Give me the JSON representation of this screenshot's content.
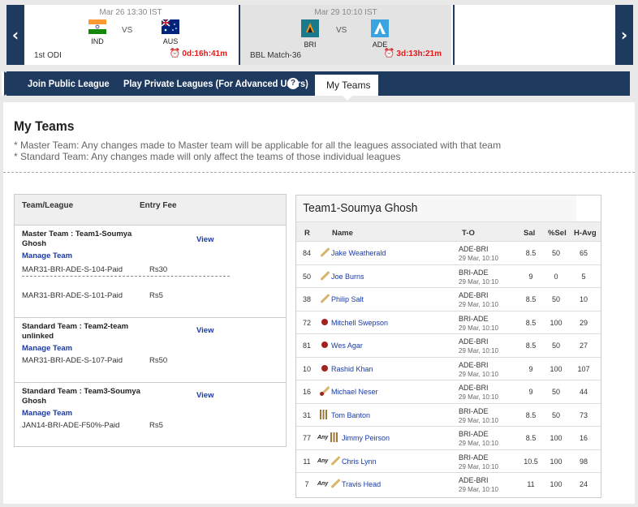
{
  "matches": [
    {
      "time": "Mar 26 13:30 IST",
      "team1": "IND",
      "team2": "AUS",
      "vs": "VS",
      "label": "1st ODI",
      "countdown": "0d:16h:41m",
      "flag1_colors": [
        "#ff9933",
        "#ffffff",
        "#138808"
      ],
      "flag2_color": "#00247d"
    },
    {
      "time": "Mar 29 10:10 IST",
      "team1": "BRI",
      "team2": "ADE",
      "vs": "VS",
      "label": "BBL Match-36",
      "countdown": "3d:13h:21m",
      "logo1_color": "#1a7a8a",
      "logo2_color": "#3aa3e0"
    }
  ],
  "nav": {
    "prev_icon": "chevron-left-icon",
    "next_icon": "chevron-right-icon",
    "prev_glyph": "‹",
    "next_glyph": "›"
  },
  "tabs": {
    "join_public": "Join Public League",
    "play_private": "Play Private Leagues (For Advanced Users)",
    "help_glyph": "?",
    "my_teams": "My Teams"
  },
  "page": {
    "title": "My Teams",
    "note1": "* Master Team: Any changes made to Master team will be applicable for all the leagues associated with that team",
    "note2": "* Standard Team: Any changes made will only affect the teams of those individual leagues"
  },
  "league_panel": {
    "col_team": "Team/League",
    "col_fee": "Entry Fee",
    "blocks": [
      {
        "title": "Master Team : Team1-Soumya Ghosh",
        "view": "View",
        "manage": "Manage Team",
        "leagues": [
          {
            "name": "MAR31-BRI-ADE-S-104-Paid",
            "fee": "Rs30"
          },
          {
            "name": "MAR31-BRI-ADE-S-101-Paid",
            "fee": "Rs5"
          }
        ]
      },
      {
        "title": "Standard Team : Team2-team unlinked",
        "view": "View",
        "manage": "Manage Team",
        "leagues": [
          {
            "name": "MAR31-BRI-ADE-S-107-Paid",
            "fee": "Rs50"
          }
        ]
      },
      {
        "title": "Standard Team : Team3-Soumya Ghosh",
        "view": "View",
        "manage": "Manage Team",
        "leagues": [
          {
            "name": "JAN14-BRI-ADE-F50%-Paid",
            "fee": "Rs5"
          }
        ]
      }
    ]
  },
  "team_table": {
    "title": "Team1-Soumya Ghosh",
    "headers": {
      "r": "R",
      "name": "Name",
      "to": "T-O",
      "sal": "Sal",
      "sel": "%Sel",
      "havg": "H-Avg"
    },
    "rows": [
      {
        "r": "84",
        "role": "bat",
        "any": "",
        "name": "Jake Weatherald",
        "to": "ADE-BRI",
        "date": "29 Mar, 10:10",
        "sal": "8.5",
        "sel": "50",
        "havg": "65"
      },
      {
        "r": "50",
        "role": "bat",
        "any": "",
        "name": "Joe Burns",
        "to": "BRI-ADE",
        "date": "29 Mar, 10:10",
        "sal": "9",
        "sel": "0",
        "havg": "5"
      },
      {
        "r": "38",
        "role": "bat",
        "any": "",
        "name": "Philip Salt",
        "to": "ADE-BRI",
        "date": "29 Mar, 10:10",
        "sal": "8.5",
        "sel": "50",
        "havg": "10"
      },
      {
        "r": "72",
        "role": "ball",
        "any": "",
        "name": "Mitchell Swepson",
        "to": "BRI-ADE",
        "date": "29 Mar, 10:10",
        "sal": "8.5",
        "sel": "100",
        "havg": "29"
      },
      {
        "r": "81",
        "role": "ball",
        "any": "",
        "name": "Wes Agar",
        "to": "ADE-BRI",
        "date": "29 Mar, 10:10",
        "sal": "8.5",
        "sel": "50",
        "havg": "27"
      },
      {
        "r": "10",
        "role": "ball",
        "any": "",
        "name": "Rashid Khan",
        "to": "ADE-BRI",
        "date": "29 Mar, 10:10",
        "sal": "9",
        "sel": "100",
        "havg": "107"
      },
      {
        "r": "16",
        "role": "ar",
        "any": "",
        "name": "Michael Neser",
        "to": "ADE-BRI",
        "date": "29 Mar, 10:10",
        "sal": "9",
        "sel": "50",
        "havg": "44"
      },
      {
        "r": "31",
        "role": "wk",
        "any": "",
        "name": "Tom Banton",
        "to": "BRI-ADE",
        "date": "29 Mar, 10:10",
        "sal": "8.5",
        "sel": "50",
        "havg": "73"
      },
      {
        "r": "77",
        "role": "wk",
        "any": "Any",
        "name": "Jimmy Peirson",
        "to": "BRI-ADE",
        "date": "29 Mar, 10:10",
        "sal": "8.5",
        "sel": "100",
        "havg": "16"
      },
      {
        "r": "11",
        "role": "bat",
        "any": "Any",
        "name": "Chris Lynn",
        "to": "BRI-ADE",
        "date": "29 Mar, 10:10",
        "sal": "10.5",
        "sel": "100",
        "havg": "98"
      },
      {
        "r": "7",
        "role": "bat",
        "any": "Any",
        "name": "Travis Head",
        "to": "ADE-BRI",
        "date": "29 Mar, 10:10",
        "sal": "11",
        "sel": "100",
        "havg": "24"
      }
    ]
  }
}
